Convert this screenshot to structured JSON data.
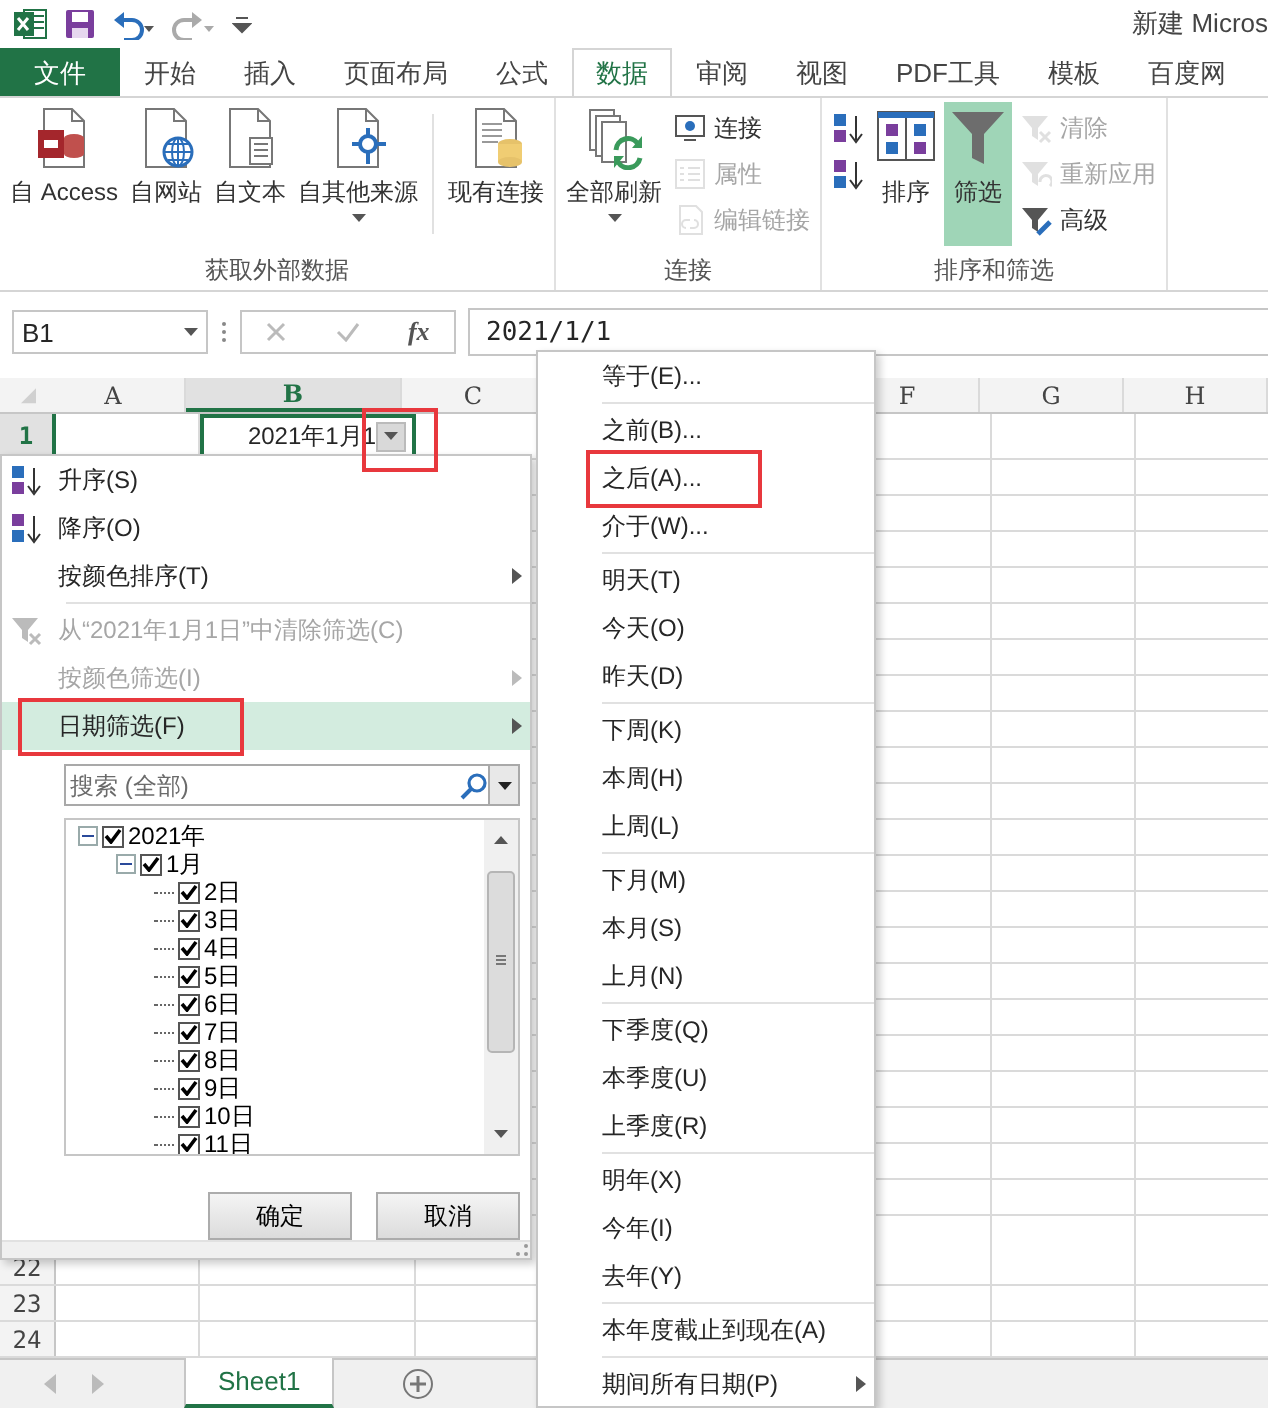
{
  "title_bar": {
    "title": "新建 Micros"
  },
  "ribbon": {
    "tabs": [
      {
        "label": "文件",
        "kind": "file",
        "selected": false
      },
      {
        "label": "开始",
        "kind": "tab",
        "selected": false
      },
      {
        "label": "插入",
        "kind": "tab",
        "selected": false
      },
      {
        "label": "页面布局",
        "kind": "tab",
        "selected": false
      },
      {
        "label": "公式",
        "kind": "tab",
        "selected": false
      },
      {
        "label": "数据",
        "kind": "tab",
        "selected": true
      },
      {
        "label": "审阅",
        "kind": "tab",
        "selected": false
      },
      {
        "label": "视图",
        "kind": "tab",
        "selected": false
      },
      {
        "label": "PDF工具",
        "kind": "tab",
        "selected": false
      },
      {
        "label": "模板",
        "kind": "tab",
        "selected": false
      },
      {
        "label": "百度网",
        "kind": "tab",
        "selected": false
      }
    ],
    "groups": [
      {
        "label": "获取外部数据",
        "items": [
          {
            "kind": "large",
            "label": "自 Access",
            "dropdown": false,
            "selected": false
          },
          {
            "kind": "large",
            "label": "自网站",
            "dropdown": false,
            "selected": false
          },
          {
            "kind": "large",
            "label": "自文本",
            "dropdown": false,
            "selected": false
          },
          {
            "kind": "large",
            "label": "自其他来源",
            "dropdown": true,
            "selected": false
          },
          {
            "kind": "separator"
          },
          {
            "kind": "large",
            "label": "现有连接",
            "dropdown": false,
            "selected": false
          }
        ]
      },
      {
        "label": "连接",
        "items": [
          {
            "kind": "large",
            "label": "全部刷新",
            "dropdown": true,
            "selected": false
          },
          {
            "kind": "stack",
            "items": [
              {
                "label": "连接",
                "disabled": false
              },
              {
                "label": "属性",
                "disabled": true
              },
              {
                "label": "编辑链接",
                "disabled": true
              }
            ]
          }
        ]
      },
      {
        "label": "排序和筛选",
        "items": [
          {
            "kind": "stack",
            "items": [
              {
                "disabled": false
              },
              {
                "disabled": false
              }
            ]
          },
          {
            "kind": "large",
            "label": "排序",
            "dropdown": false,
            "selected": false
          },
          {
            "kind": "large",
            "label": "筛选",
            "dropdown": false,
            "selected": true
          },
          {
            "kind": "stack",
            "items": [
              {
                "label": "清除",
                "disabled": true
              },
              {
                "label": "重新应用",
                "disabled": true
              },
              {
                "label": "高级",
                "disabled": false
              }
            ]
          }
        ]
      }
    ]
  },
  "formula_bar": {
    "name_box": "B1",
    "function_label": "fx",
    "formula": "2021/1/1"
  },
  "sheet": {
    "columns": [
      {
        "label": "A",
        "selected": false
      },
      {
        "label": "B",
        "selected": true
      },
      {
        "label": "C",
        "selected": false
      },
      {
        "label": "F",
        "selected": false
      },
      {
        "label": "G",
        "selected": false
      },
      {
        "label": "H",
        "selected": false
      }
    ],
    "rows": [
      {
        "number": "1",
        "selected": true
      },
      {
        "number": "22",
        "selected": false
      },
      {
        "number": "23",
        "selected": false
      },
      {
        "number": "24",
        "selected": false
      }
    ],
    "active_cell": {
      "text": "2021年1月1"
    },
    "filter_button": {
      "highlighted": true
    }
  },
  "sheet_tabs": [
    {
      "label": "Sheet1",
      "selected": true
    }
  ],
  "filter_menu": {
    "items": [
      {
        "kind": "sort_ascending",
        "label": "升序(S)",
        "disabled": false,
        "submenu": false,
        "selected": false,
        "highlighted": false
      },
      {
        "kind": "sort_descending",
        "label": "降序(O)",
        "disabled": false,
        "submenu": false,
        "selected": false,
        "highlighted": false
      },
      {
        "kind": "item",
        "label": "按颜色排序(T)",
        "disabled": false,
        "submenu": true,
        "selected": false,
        "highlighted": false
      },
      {
        "kind": "separator"
      },
      {
        "kind": "clear_filter",
        "label": "从“2021年1月1日”中清除筛选(C)",
        "disabled": true,
        "submenu": false,
        "selected": false,
        "highlighted": false
      },
      {
        "kind": "item",
        "label": "按颜色筛选(I)",
        "disabled": true,
        "submenu": true,
        "selected": false,
        "highlighted": false
      },
      {
        "kind": "item",
        "label": "日期筛选(F)",
        "disabled": false,
        "submenu": true,
        "selected": true,
        "highlighted": true
      }
    ],
    "search": {
      "placeholder": "搜索 (全部)"
    },
    "tree": [
      {
        "label": "2021年",
        "checked": true,
        "expanded": true,
        "children": [
          {
            "label": "1月",
            "checked": true,
            "expanded": true,
            "children": [
              {
                "label": "2日",
                "checked": true
              },
              {
                "label": "3日",
                "checked": true
              },
              {
                "label": "4日",
                "checked": true
              },
              {
                "label": "5日",
                "checked": true
              },
              {
                "label": "6日",
                "checked": true
              },
              {
                "label": "7日",
                "checked": true
              },
              {
                "label": "8日",
                "checked": true
              },
              {
                "label": "9日",
                "checked": true
              },
              {
                "label": "10日",
                "checked": true
              },
              {
                "label": "11日",
                "checked": true
              }
            ]
          }
        ]
      }
    ],
    "buttons": [
      "确定",
      "取消"
    ]
  },
  "date_filter_menu": {
    "items": [
      {
        "kind": "item",
        "label": "等于(E)...",
        "submenu": false,
        "highlighted": false
      },
      {
        "kind": "separator"
      },
      {
        "kind": "item",
        "label": "之前(B)...",
        "submenu": false,
        "highlighted": false
      },
      {
        "kind": "item",
        "label": "之后(A)...",
        "submenu": false,
        "highlighted": true
      },
      {
        "kind": "item",
        "label": "介于(W)...",
        "submenu": false,
        "highlighted": false
      },
      {
        "kind": "separator"
      },
      {
        "kind": "item",
        "label": "明天(T)",
        "submenu": false,
        "highlighted": false
      },
      {
        "kind": "item",
        "label": "今天(O)",
        "submenu": false,
        "highlighted": false
      },
      {
        "kind": "item",
        "label": "昨天(D)",
        "submenu": false,
        "highlighted": false
      },
      {
        "kind": "separator"
      },
      {
        "kind": "item",
        "label": "下周(K)",
        "submenu": false,
        "highlighted": false
      },
      {
        "kind": "item",
        "label": "本周(H)",
        "submenu": false,
        "highlighted": false
      },
      {
        "kind": "item",
        "label": "上周(L)",
        "submenu": false,
        "highlighted": false
      },
      {
        "kind": "separator"
      },
      {
        "kind": "item",
        "label": "下月(M)",
        "submenu": false,
        "highlighted": false
      },
      {
        "kind": "item",
        "label": "本月(S)",
        "submenu": false,
        "highlighted": false
      },
      {
        "kind": "item",
        "label": "上月(N)",
        "submenu": false,
        "highlighted": false
      },
      {
        "kind": "separator"
      },
      {
        "kind": "item",
        "label": "下季度(Q)",
        "submenu": false,
        "highlighted": false
      },
      {
        "kind": "item",
        "label": "本季度(U)",
        "submenu": false,
        "highlighted": false
      },
      {
        "kind": "item",
        "label": "上季度(R)",
        "submenu": false,
        "highlighted": false
      },
      {
        "kind": "separator"
      },
      {
        "kind": "item",
        "label": "明年(X)",
        "submenu": false,
        "highlighted": false
      },
      {
        "kind": "item",
        "label": "今年(I)",
        "submenu": false,
        "highlighted": false
      },
      {
        "kind": "item",
        "label": "去年(Y)",
        "submenu": false,
        "highlighted": false
      },
      {
        "kind": "separator"
      },
      {
        "kind": "item",
        "label": "本年度截止到现在(A)",
        "submenu": false,
        "highlighted": false
      },
      {
        "kind": "separator"
      },
      {
        "kind": "item",
        "label": "期间所有日期(P)",
        "submenu": true,
        "highlighted": false
      }
    ]
  }
}
